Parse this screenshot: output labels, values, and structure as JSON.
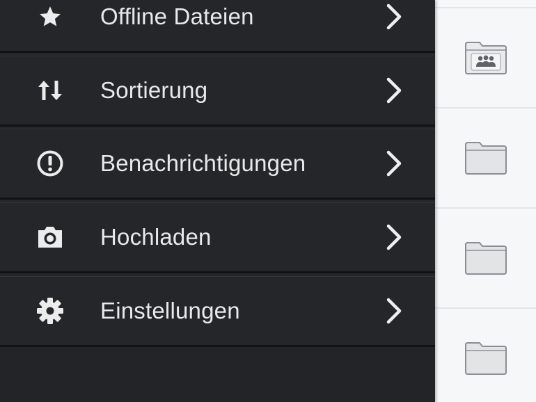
{
  "menu": {
    "items": [
      {
        "label": "Offline Dateien",
        "icon": "star-icon"
      },
      {
        "label": "Sortierung",
        "icon": "sort-arrows-icon"
      },
      {
        "label": "Benachrichtigungen",
        "icon": "exclamation-circle-icon"
      },
      {
        "label": "Hochladen",
        "icon": "camera-icon"
      },
      {
        "label": "Einstellungen",
        "icon": "gear-icon"
      }
    ],
    "chevron_icon": "chevron-right-icon"
  },
  "content": {
    "rows": [
      {
        "icon": "shared-folder-icon"
      },
      {
        "icon": "folder-icon"
      },
      {
        "icon": "folder-icon"
      },
      {
        "icon": "folder-icon"
      }
    ]
  },
  "colors": {
    "menu_background": "#252629",
    "menu_text": "#e9e9ea",
    "divider": "#111214",
    "content_background": "#f6f7f9"
  }
}
